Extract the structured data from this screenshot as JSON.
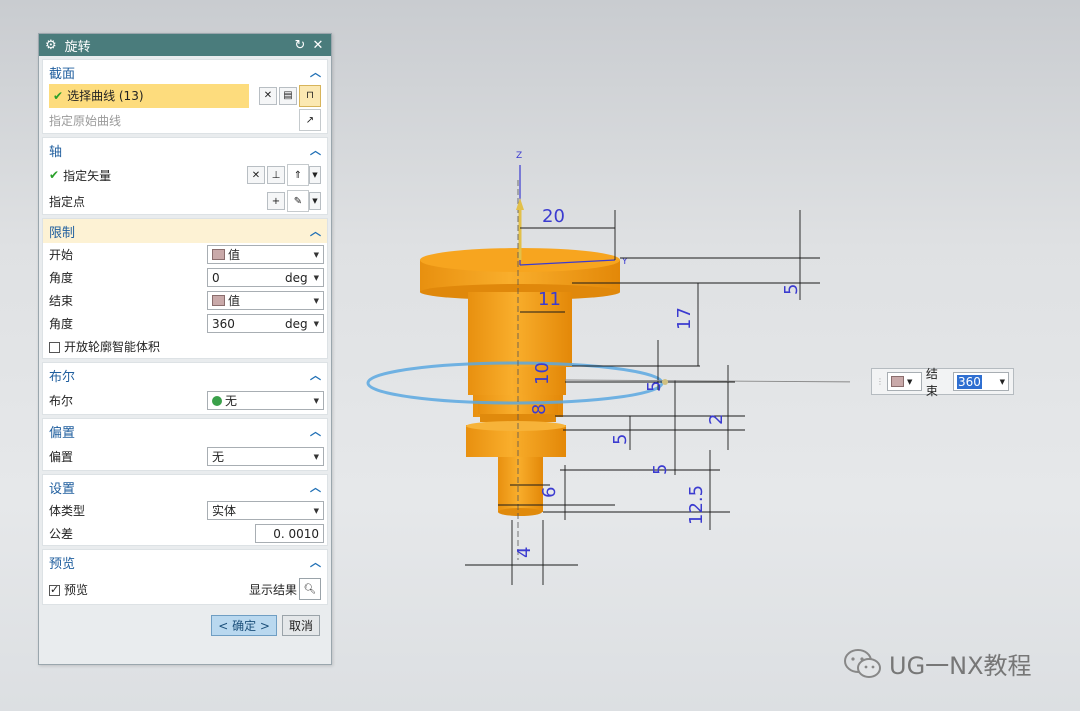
{
  "dialog": {
    "title": "旋转",
    "section_label": {
      "title": "截面",
      "select_curve": "选择曲线 (13)",
      "specify_origin_curve": "指定原始曲线"
    },
    "axis": {
      "title": "轴",
      "specify_vector": "指定矢量",
      "specify_point": "指定点"
    },
    "limits": {
      "title": "限制",
      "start_label": "开始",
      "start_value": "值",
      "start_angle_label": "角度",
      "start_angle": "0",
      "end_label": "结束",
      "end_value": "值",
      "end_angle_label": "角度",
      "end_angle": "360",
      "unit": "deg",
      "open_profile": "开放轮廓智能体积"
    },
    "boolean": {
      "title": "布尔",
      "label": "布尔",
      "value": "无"
    },
    "offset": {
      "title": "偏置",
      "label": "偏置",
      "value": "无"
    },
    "settings": {
      "title": "设置",
      "body_type_label": "体类型",
      "body_type": "实体",
      "tolerance_label": "公差",
      "tolerance": "0. 0010"
    },
    "preview": {
      "title": "预览",
      "label": "预览",
      "show_result": "显示结果"
    },
    "ok": "< 确定 >",
    "cancel": "取消"
  },
  "viewport": {
    "axis_z": "Z",
    "axis_y": "Y",
    "dimensions": [
      "20",
      "11",
      "17",
      "5",
      "10",
      "8",
      "5",
      "2",
      "5",
      "5",
      "6",
      "12.5",
      "4"
    ],
    "float_label": "结束",
    "float_value": "360"
  },
  "watermark": "UG一NX教程",
  "colors": {
    "title_bar": "#4a7c7c",
    "part": "#f5a21b",
    "selection": "#fddc7d",
    "dimension": "#3b3bd0",
    "preview_ring": "#5aa8e0"
  }
}
